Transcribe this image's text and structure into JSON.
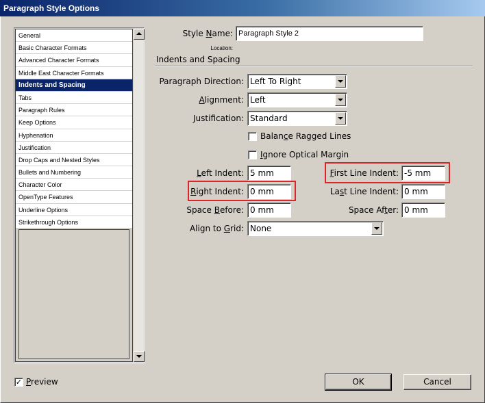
{
  "window": {
    "title": "Paragraph Style Options"
  },
  "sidebar": {
    "items": [
      "General",
      "Basic Character Formats",
      "Advanced Character Formats",
      "Middle East Character Formats",
      "Indents and Spacing",
      "Tabs",
      "Paragraph Rules",
      "Keep Options",
      "Hyphenation",
      "Justification",
      "Drop Caps and Nested Styles",
      "Bullets and Numbering",
      "Character Color",
      "OpenType Features",
      "Underline Options",
      "Strikethrough Options"
    ],
    "selected": "Indents and Spacing"
  },
  "style_name": {
    "label": "Style Name:",
    "value": "Paragraph Style 2"
  },
  "location": {
    "label": "Location:"
  },
  "section": {
    "title": "Indents and Spacing"
  },
  "paragraph_direction": {
    "label": "Paragraph Direction:",
    "value": "Left To Right"
  },
  "alignment": {
    "label": "Alignment:",
    "value": "Left"
  },
  "justification": {
    "label": "Justification:",
    "value": "Standard"
  },
  "balance_ragged_lines": {
    "label": "Balance Ragged Lines",
    "checked": false
  },
  "ignore_optical_margin": {
    "label": "Ignore Optical Margin",
    "checked": false
  },
  "left_indent": {
    "label": "Left Indent:",
    "value": "5 mm"
  },
  "first_line_indent": {
    "label": "First Line Indent:",
    "value": "-5 mm"
  },
  "right_indent": {
    "label": "Right Indent:",
    "value": "0 mm"
  },
  "last_line_indent": {
    "label": "Last Line Indent:",
    "value": "0 mm"
  },
  "space_before": {
    "label": "Space Before:",
    "value": "0 mm"
  },
  "space_after": {
    "label": "Space After:",
    "value": "0 mm"
  },
  "align_to_grid": {
    "label": "Align to Grid:",
    "value": "None"
  },
  "preview": {
    "label": "Preview",
    "checked": true,
    "check_glyph": "✓"
  },
  "buttons": {
    "ok": "OK",
    "cancel": "Cancel"
  },
  "colors": {
    "highlight": "#d8262b",
    "selection": "#0a246a",
    "dialog": "#d4d0c8"
  }
}
